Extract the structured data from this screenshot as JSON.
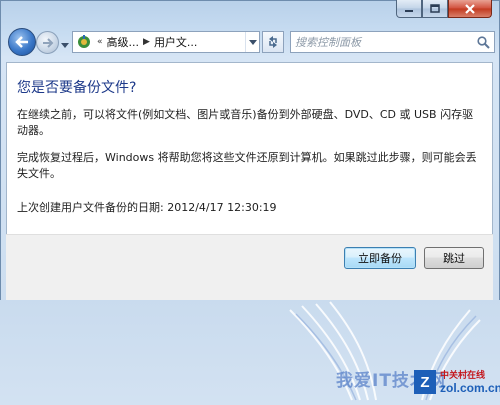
{
  "window": {
    "controls": {
      "minimize_icon": "minimize-icon",
      "maximize_icon": "maximize-icon",
      "close_icon": "close-icon"
    }
  },
  "address_bar": {
    "overflow": "«",
    "crumbs": [
      "高级...",
      "用户文..."
    ],
    "refresh_icon": "refresh-icon",
    "dropdown_icon": "chevron-down-icon"
  },
  "search": {
    "placeholder": "搜索控制面板",
    "icon": "search-icon"
  },
  "dialog": {
    "heading": "您是否要备份文件?",
    "paragraph1": "在继续之前，可以将文件(例如文档、图片或音乐)备份到外部硬盘、DVD、CD 或 USB 闪存驱动器。",
    "paragraph2": "完成恢复过程后，Windows 将帮助您将这些文件还原到计算机。如果跳过此步骤，则可能会丢失文件。",
    "last_backup_label": "上次创建用户文件备份的日期:",
    "last_backup_value": "2012/4/17 12:30:19"
  },
  "buttons": {
    "backup": "立即备份",
    "skip": "跳过"
  },
  "watermark": {
    "text": "我爱IT技术网",
    "logo_cn": "中关村在线",
    "logo_en": "zol.com.cn",
    "logo_mark": "Z"
  },
  "colors": {
    "heading": "#1e3a8a",
    "close_button": "#c23a20",
    "frame": "#c9dbee"
  }
}
